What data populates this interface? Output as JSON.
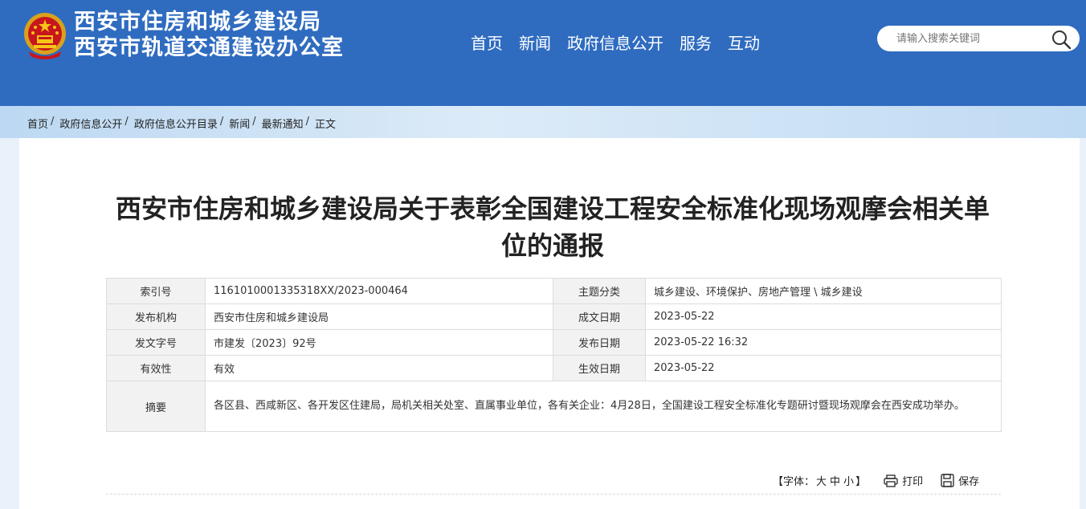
{
  "header": {
    "site_name_line1": "西安市住房和城乡建设局",
    "site_name_line2": "西安市轨道交通建设办公室",
    "nav": [
      "首页",
      "新闻",
      "政府信息公开",
      "服务",
      "互动"
    ],
    "search_placeholder": "请输入搜索关键词",
    "brand_color": "#2f6cc0"
  },
  "breadcrumb": [
    "首页",
    "政府信息公开",
    "政府信息公开目录",
    "新闻",
    "最新通知",
    "正文"
  ],
  "article": {
    "title_line1": "西安市住房和城乡建设局关于表彰全国建设工程安全标准化现场观摩会相关单",
    "title_line2": "位的通报"
  },
  "info": {
    "index_label": "索引号",
    "index_value": "1161010001335318XX/2023-000464",
    "topic_label": "主题分类",
    "topic_value": "城乡建设、环境保护、房地产管理 \\ 城乡建设",
    "org_label": "发布机构",
    "org_value": "西安市住房和城乡建设局",
    "made_label": "成文日期",
    "made_value": "2023-05-22",
    "doc_label": "发文字号",
    "doc_value": "市建发〔2023〕92号",
    "pub_label": "发布日期",
    "pub_value": "2023-05-22 16:32",
    "valid_label": "有效性",
    "valid_value": "有效",
    "eff_label": "生效日期",
    "eff_value": "2023-05-22",
    "abstract_label": "摘要",
    "abstract_value": "各区县、西咸新区、各开发区住建局，局机关相关处室、直属事业单位，各有关企业：4月28日，全国建设工程安全标准化专题研讨暨现场观摩会在西安成功举办。"
  },
  "toolbar": {
    "font_prefix": "【字体：",
    "font_large": "大",
    "font_medium": "中",
    "font_small": "小",
    "font_suffix": "】",
    "print_label": "打印",
    "save_label": "保存"
  }
}
